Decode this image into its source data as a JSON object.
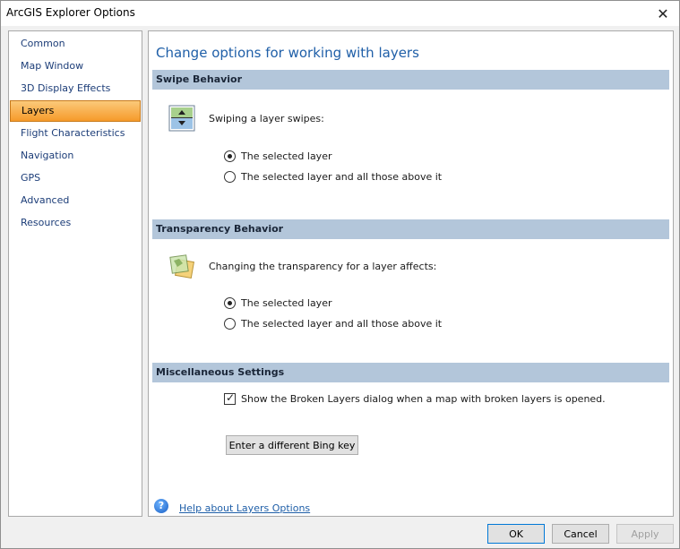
{
  "window": {
    "title": "ArcGIS Explorer Options"
  },
  "nav": {
    "items": [
      {
        "label": "Common"
      },
      {
        "label": "Map Window"
      },
      {
        "label": "3D Display Effects"
      },
      {
        "label": "Layers"
      },
      {
        "label": "Flight Characteristics"
      },
      {
        "label": "Navigation"
      },
      {
        "label": "GPS"
      },
      {
        "label": "Advanced"
      },
      {
        "label": "Resources"
      }
    ],
    "selected": "Layers"
  },
  "content": {
    "heading": "Change options for working with layers",
    "swipe": {
      "title": "Swipe Behavior",
      "icon": "swipe-icon",
      "prompt": "Swiping a layer swipes:",
      "options": [
        {
          "label": "The selected layer",
          "checked": true
        },
        {
          "label": "The selected layer and all those above it",
          "checked": false
        }
      ]
    },
    "transparency": {
      "title": "Transparency Behavior",
      "icon": "transparency-icon",
      "prompt": "Changing the transparency for a layer affects:",
      "options": [
        {
          "label": "The selected layer",
          "checked": true
        },
        {
          "label": "The selected layer and all those above it",
          "checked": false
        }
      ]
    },
    "misc": {
      "title": "Miscellaneous Settings",
      "broken_layers_label": "Show the Broken Layers dialog when a map with broken layers is opened.",
      "broken_layers_checked": true,
      "bing_button": "Enter a different Bing key"
    },
    "help_link": "Help about Layers Options"
  },
  "footer": {
    "ok": "OK",
    "cancel": "Cancel",
    "apply": "Apply"
  },
  "colors": {
    "selected_nav": "#f69a2a",
    "section_bar": "#b3c6da",
    "heading": "#1f5fa8",
    "link": "#1f5fa8"
  }
}
